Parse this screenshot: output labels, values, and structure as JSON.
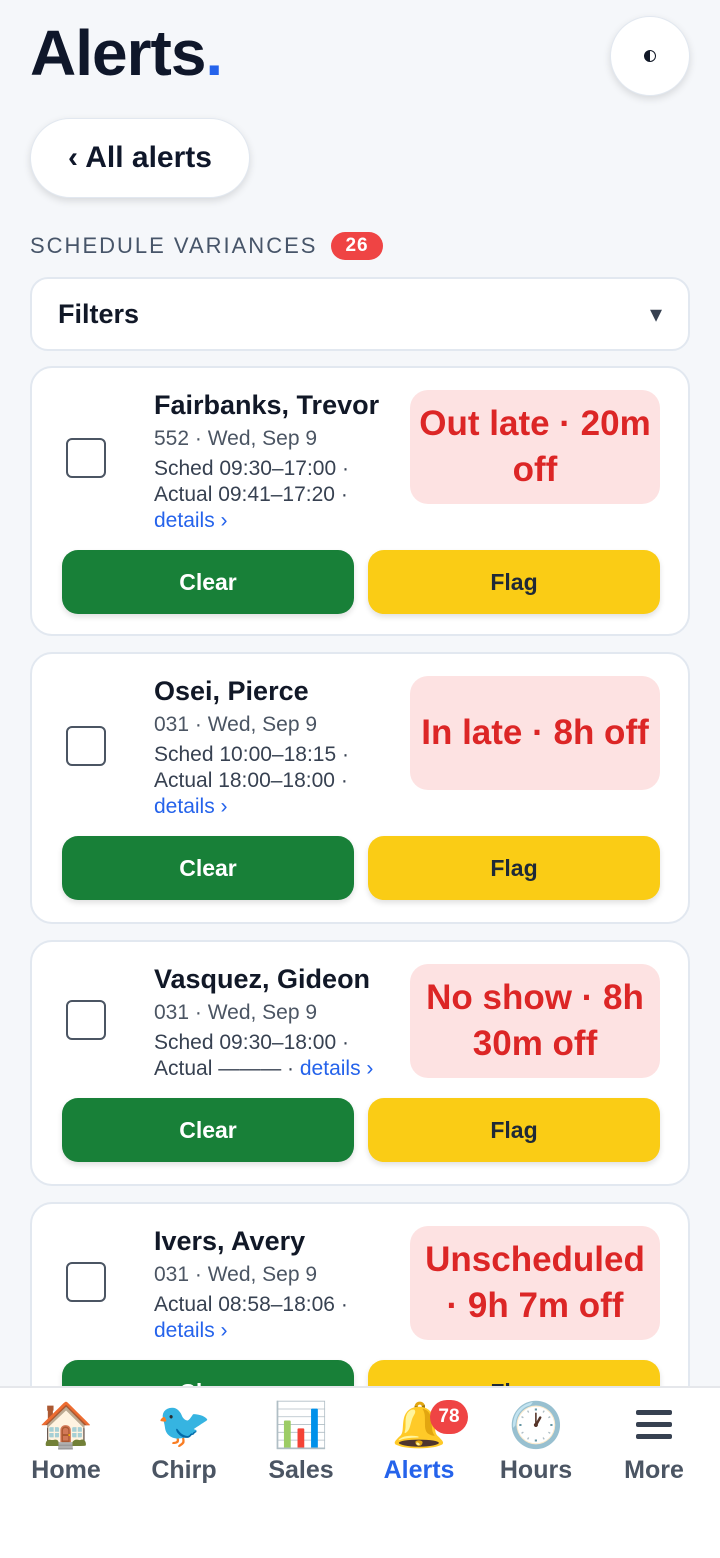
{
  "header": {
    "title": "Alerts",
    "title_dot": "."
  },
  "back_label": "‹ All alerts",
  "section": {
    "label": "SCHEDULE VARIANCES",
    "count": "26"
  },
  "filters": {
    "label": "Filters",
    "caret": "▾"
  },
  "cards": [
    {
      "name": "Fairbanks, Trevor",
      "store_date": "552 · Wed, Sep 9",
      "sched": "Sched 09:30–17:00 ·",
      "actual": "Actual 09:41–17:20 ·",
      "details": "details ›",
      "variance": "Out late · 20m off",
      "clear": "Clear",
      "flag": "Flag"
    },
    {
      "name": "Osei, Pierce",
      "store_date": "031 · Wed, Sep 9",
      "sched": "Sched 10:00–18:15 ·",
      "actual": "Actual 18:00–18:00 ·",
      "details": "details ›",
      "variance": "In late · 8h off",
      "clear": "Clear",
      "flag": "Flag"
    },
    {
      "name": "Vasquez, Gideon",
      "store_date": "031 · Wed, Sep 9",
      "sched": "Sched 09:30–18:00 ·",
      "actual": "Actual ——— · ",
      "details": "details ›",
      "variance": "No show · 8h 30m off",
      "clear": "Clear",
      "flag": "Flag"
    },
    {
      "name": "Ivers, Avery",
      "store_date": "031 · Wed, Sep 9",
      "actual": "Actual 08:58–18:06 ·",
      "details": "details ›",
      "variance": "Unscheduled · 9h 7m off",
      "clear": "Clear",
      "flag": "Flag"
    }
  ],
  "nav": [
    {
      "label": "Home",
      "icon": "🏠"
    },
    {
      "label": "Chirp",
      "icon": "🐦"
    },
    {
      "label": "Sales",
      "icon": "📊"
    },
    {
      "label": "Alerts",
      "icon": "🔔",
      "badge": "78",
      "active": true
    },
    {
      "label": "Hours",
      "icon": "🕐"
    },
    {
      "label": "More",
      "icon": "☰"
    }
  ],
  "colors": {
    "accent": "#2563eb",
    "clear": "#188038",
    "flag": "#facc15",
    "variance_bg": "#fde2e2",
    "variance_text": "#dc2626",
    "badge": "#ef4444"
  }
}
